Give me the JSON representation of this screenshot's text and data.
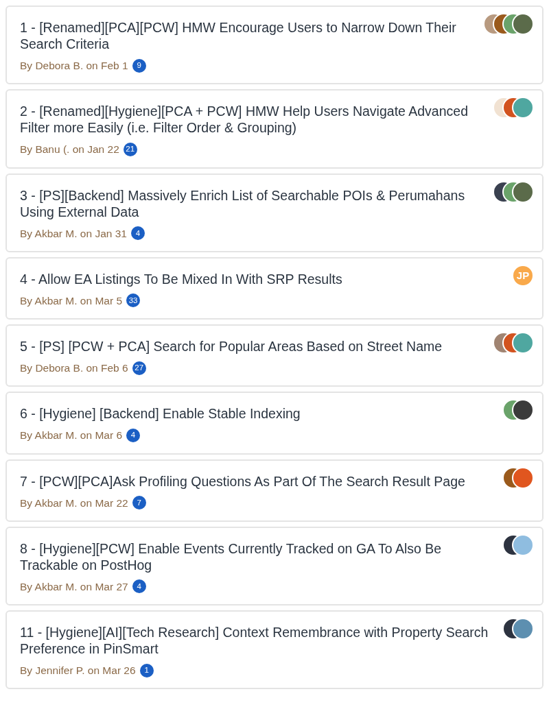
{
  "items": [
    {
      "title": "1 - [Renamed][PCA][PCW] HMW Encourage Users to Narrow Down Their Search Criteria",
      "author": "By Debora B. on Feb 1",
      "count": "9"
    },
    {
      "title": "2 - [Renamed][Hygiene][PCA + PCW] HMW Help Users Navigate Advanced Filter more Easily (i.e. Filter Order & Grouping)",
      "author": "By Banu (. on Jan 22",
      "count": "21"
    },
    {
      "title": "3 - [PS][Backend] Massively Enrich List of Searchable POIs & Perumahans Using External Data",
      "author": "By Akbar M. on Jan 31",
      "count": "4"
    },
    {
      "title": "4 - Allow EA Listings To Be Mixed In With SRP Results",
      "author": "By Akbar M. on Mar 5",
      "count": "33",
      "avatars": [
        {
          "kind": "initials",
          "text": "JP",
          "color": "#f9a94b"
        }
      ]
    },
    {
      "title": "5 - [PS] [PCW + PCA] Search for Popular Areas Based on Street Name",
      "author": "By Debora B. on Feb 6",
      "count": "27"
    },
    {
      "title": "6 - [Hygiene] [Backend] Enable Stable Indexing",
      "author": "By Akbar M. on Mar 6",
      "count": "4"
    },
    {
      "title": "7 - [PCW][PCA]Ask Profiling Questions As Part Of The Search Result Page",
      "author": "By Akbar M. on Mar 22",
      "count": "7"
    },
    {
      "title": "8 - [Hygiene][PCW] Enable Events Currently Tracked on GA To Also Be Trackable on PostHog",
      "author": "By Akbar M. on Mar 27",
      "count": "4"
    },
    {
      "title": "11 - [Hygiene][AI][Tech Research] Context Remembrance with Property Search Preference in PinSmart",
      "author": "By Jennifer P. on Mar 26",
      "count": "1"
    }
  ]
}
